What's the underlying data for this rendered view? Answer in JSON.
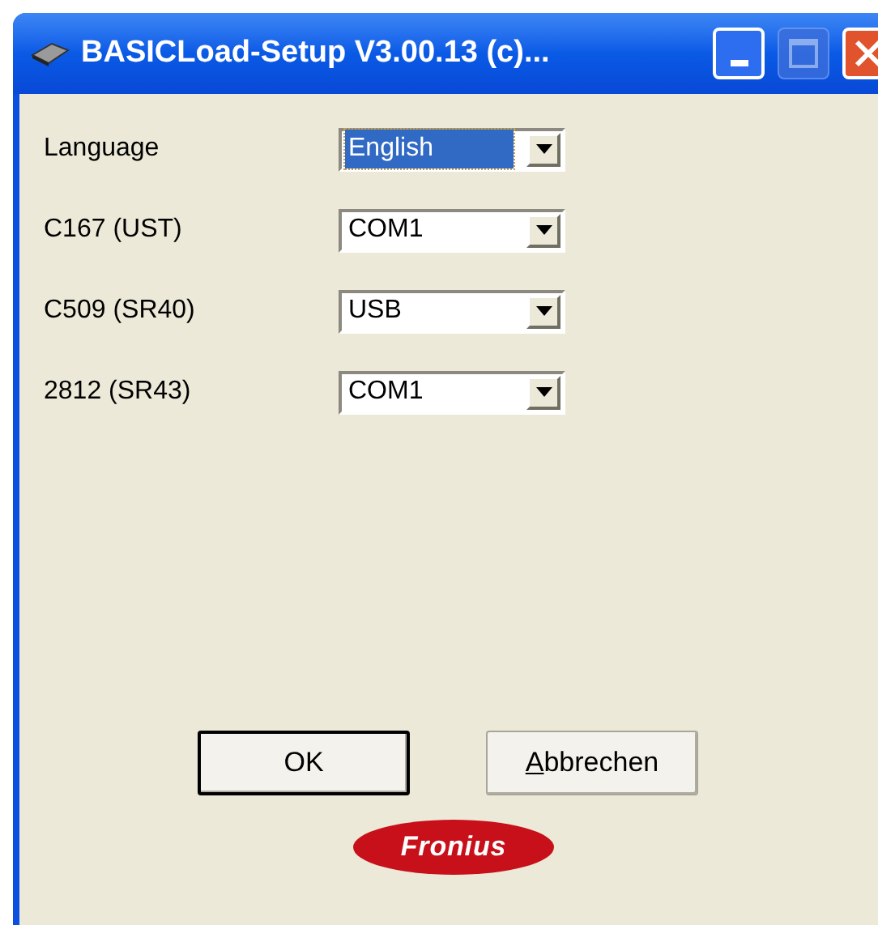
{
  "window": {
    "title": "BASICLoad-Setup V3.00.13  (c)..."
  },
  "fields": [
    {
      "label": "Language",
      "value": "English",
      "focused": true
    },
    {
      "label": "C167 (UST)",
      "value": "COM1",
      "focused": false
    },
    {
      "label": "C509 (SR40)",
      "value": "USB",
      "focused": false
    },
    {
      "label": "2812 (SR43)",
      "value": "COM1",
      "focused": false
    }
  ],
  "buttons": [
    {
      "label": "OK",
      "default": true
    },
    {
      "label": "Abbrechen",
      "default": false
    }
  ],
  "logo": {
    "text": "Fronius"
  }
}
